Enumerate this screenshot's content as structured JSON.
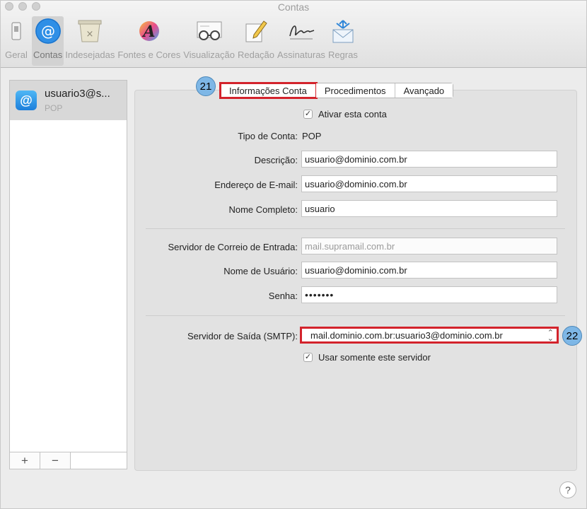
{
  "window": {
    "title": "Contas"
  },
  "toolbar": {
    "items": [
      {
        "label": "Geral",
        "icon": "switch-icon"
      },
      {
        "label": "Contas",
        "icon": "at-sign-icon",
        "active": true
      },
      {
        "label": "Indesejadas",
        "icon": "junk-bin-icon"
      },
      {
        "label": "Fontes e Cores",
        "icon": "font-color-icon"
      },
      {
        "label": "Visualização",
        "icon": "glasses-icon"
      },
      {
        "label": "Redação",
        "icon": "compose-pencil-icon"
      },
      {
        "label": "Assinaturas",
        "icon": "signature-icon"
      },
      {
        "label": "Regras",
        "icon": "rules-envelope-icon"
      }
    ]
  },
  "sidebar": {
    "account": {
      "name": "usuario3@s...",
      "type": "POP"
    },
    "add_label": "+",
    "remove_label": "−"
  },
  "tabs": [
    {
      "label": "Informações Conta",
      "selected": true
    },
    {
      "label": "Procedimentos"
    },
    {
      "label": "Avançado"
    }
  ],
  "annotations": {
    "badge_tabs": "21",
    "badge_smtp": "22"
  },
  "form": {
    "enable_account": {
      "label": "Ativar esta conta",
      "checked": true
    },
    "account_type": {
      "label": "Tipo de Conta:",
      "value": "POP"
    },
    "description": {
      "label": "Descrição:",
      "value": "usuario@dominio.com.br"
    },
    "email": {
      "label": "Endereço de E-mail:",
      "value": "usuario@dominio.com.br"
    },
    "full_name": {
      "label": "Nome Completo:",
      "value": "usuario"
    },
    "incoming_server": {
      "label": "Servidor de Correio de Entrada:",
      "placeholder": "mail.supramail.com.br"
    },
    "username": {
      "label": "Nome de Usuário:",
      "value": "usuario@dominio.com.br"
    },
    "password": {
      "label": "Senha:",
      "value": "•••••••"
    },
    "smtp": {
      "label": "Servidor de Saída (SMTP):",
      "value": "mail.dominio.com.br:usuario3@dominio.com.br"
    },
    "only_this_server": {
      "label": "Usar somente este servidor",
      "checked": true
    }
  },
  "help": {
    "label": "?"
  },
  "colors": {
    "highlight": "#d3232c",
    "badge": "#7eb7e6",
    "accent": "#1d7fdb"
  }
}
